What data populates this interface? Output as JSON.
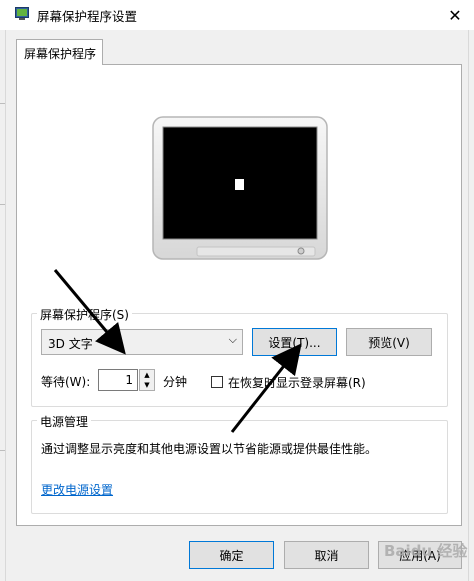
{
  "window": {
    "title": "屏幕保护程序设置"
  },
  "tabs": [
    {
      "label": "屏幕保护程序"
    }
  ],
  "screensaver": {
    "group_label": "屏幕保护程序(S)",
    "selected": "3D 文字",
    "settings_button": "设置(T)...",
    "preview_button": "预览(V)",
    "wait_label": "等待(W):",
    "wait_value": "1",
    "wait_unit": "分钟",
    "resume_checkbox_label": "在恢复时显示登录屏幕(R)",
    "resume_checked": false
  },
  "power": {
    "group_label": "电源管理",
    "description": "通过调整显示亮度和其他电源设置以节省能源或提供最佳性能。",
    "link": "更改电源设置"
  },
  "buttons": {
    "ok": "确定",
    "cancel": "取消",
    "apply": "应用(A)"
  },
  "watermark": "Baidu 经验",
  "colors": {
    "accent": "#0078d7",
    "link": "#0066cc"
  }
}
